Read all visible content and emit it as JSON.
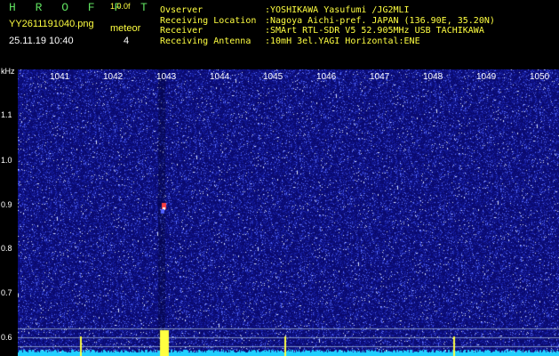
{
  "header": {
    "app_title": "H R O F F T",
    "app_version": "1.0.0f",
    "filename": "YY2611191040.png",
    "datetime": "25.11.19 10:40",
    "meteor_label": "meteor",
    "meteor_count": "4"
  },
  "info": [
    {
      "label": "Ovserver",
      "value": ":YOSHIKAWA Yasufumi /JG2MLI"
    },
    {
      "label": "Receiving Location",
      "value": ":Nagoya Aichi-pref. JAPAN (136.90E, 35.20N)"
    },
    {
      "label": "Receiver",
      "value": ":SMArt RTL-SDR V5 52.905MHz USB TACHIKAWA"
    },
    {
      "label": "Receiving Antenna",
      "value": ":10mH 3el.YAGI Horizontal:ENE"
    }
  ],
  "spectrogram": {
    "unit": "kHz",
    "y_ticks": [
      "1.1",
      "1.0",
      "0.9",
      "0.8",
      "0.7",
      "0.6"
    ],
    "x_ticks": [
      "1041",
      "1042",
      "1043",
      "1044",
      "1045",
      "1046",
      "1047",
      "1048",
      "1049",
      "1050"
    ],
    "colors": {
      "background": "#0a0a70",
      "noise": "#5060ff",
      "bright": "#e0e8ff",
      "meteor": "#ff4040",
      "baseline": "#20d0ff",
      "marker": "#ffff40"
    }
  }
}
